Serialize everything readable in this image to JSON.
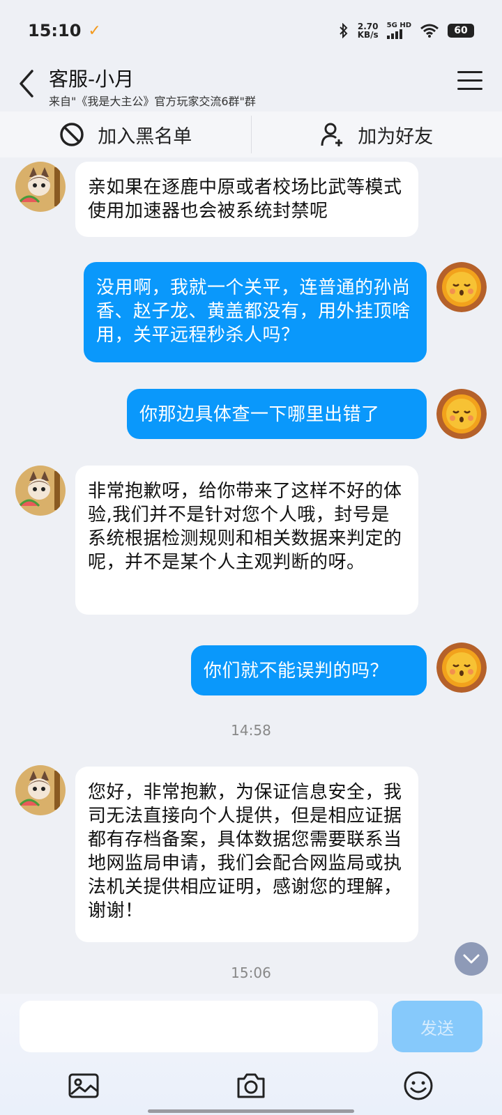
{
  "status_bar": {
    "time": "15:10",
    "speed_value": "2.70",
    "speed_unit": "KB/s",
    "network": "5G HD",
    "battery": "60"
  },
  "header": {
    "title": "客服-小月",
    "subtitle": "来自\"《我是大主公》官方玩家交流6群\"群"
  },
  "actions": {
    "blacklist_label": "加入黑名单",
    "add_friend_label": "加为好友"
  },
  "messages": [
    {
      "side": "in",
      "text": "亲如果在逐鹿中原或者校场比武等模式使用加速器也会被系统封禁呢"
    },
    {
      "side": "out",
      "text": "没用啊，我就一个关平，连普通的孙尚香、赵子龙、黄盖都没有，用外挂顶啥用，关平远程秒杀人吗？"
    },
    {
      "side": "out",
      "text": "你那边具体查一下哪里出错了"
    },
    {
      "side": "in",
      "text": "非常抱歉呀，给你带来了这样不好的体验,我们并不是针对您个人哦，封号是系统根据检测规则和相关数据来判定的呢，并不是某个人主观判断的呀。"
    },
    {
      "side": "out",
      "text": "你们就不能误判的吗？"
    },
    {
      "side": "in",
      "text": "您好，非常抱歉，为保证信息安全，我司无法直接向个人提供，但是相应证据都有存档备案，具体数据您需要联系当地网监局申请，我们会配合网监局或执法机关提供相应证明，感谢您的理解，谢谢！"
    }
  ],
  "timestamps": [
    "14:58",
    "15:06"
  ],
  "composer": {
    "placeholder": "",
    "send_label": "发送"
  },
  "colors": {
    "outgoing_bubble": "#0a98fb",
    "incoming_bubble": "#ffffff",
    "background": "#eef0f5",
    "send_button_disabled": "#86c9fb"
  },
  "icons": [
    "back-icon",
    "menu-icon",
    "block-icon",
    "add-user-icon",
    "chevron-down-icon",
    "image-icon",
    "camera-icon",
    "emoji-icon"
  ]
}
